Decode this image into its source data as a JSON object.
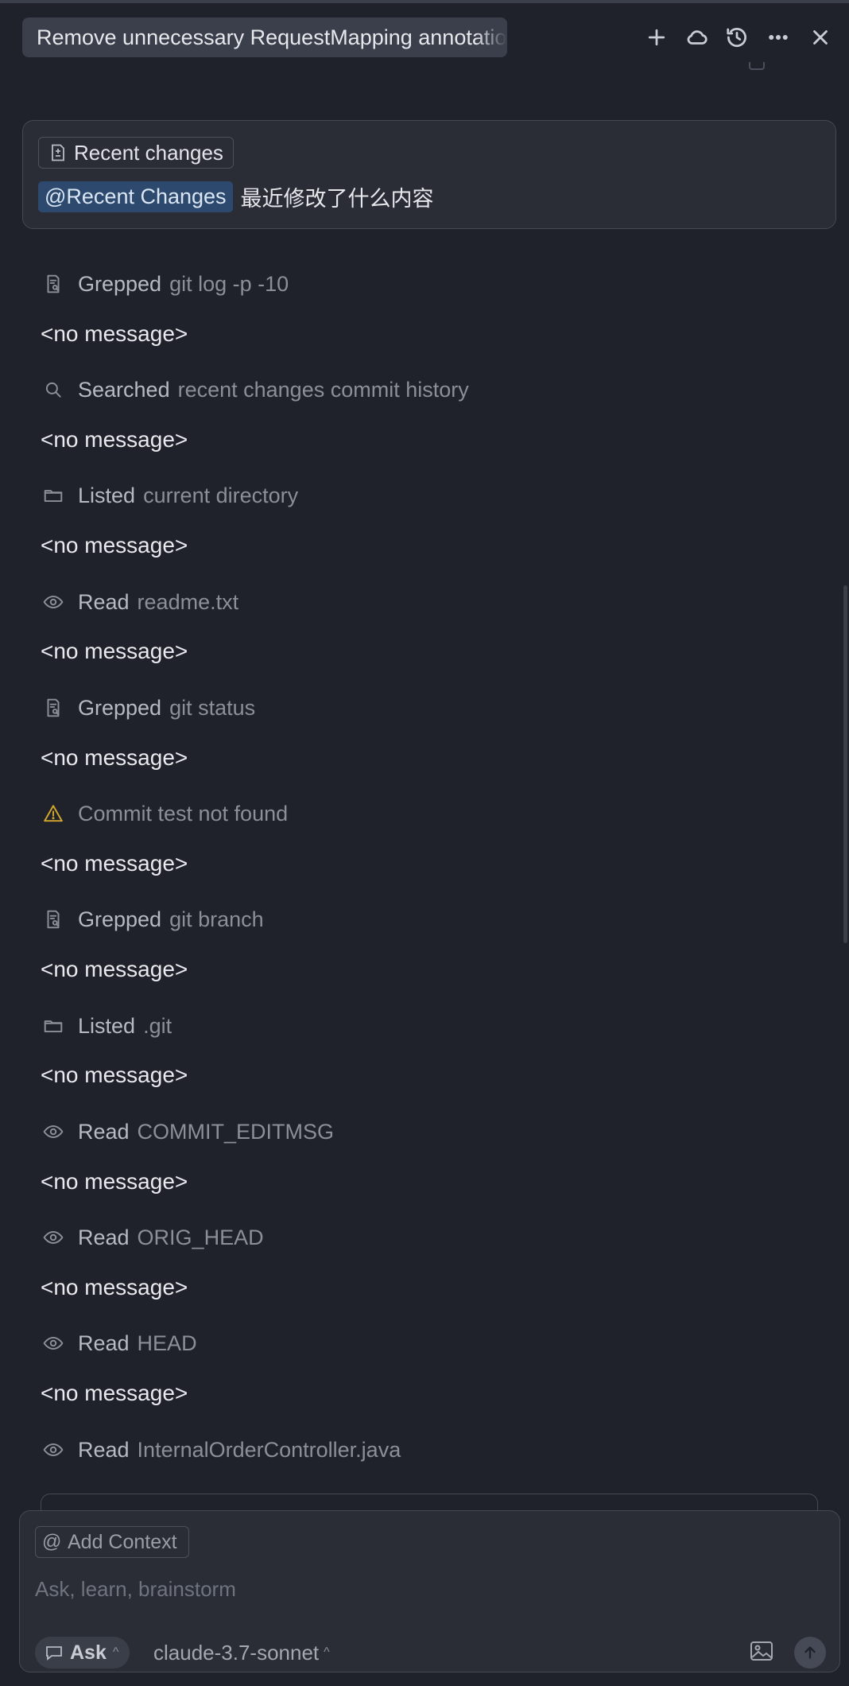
{
  "header": {
    "title": "Remove unnecessary RequestMapping annotation",
    "icons": [
      "plus-icon",
      "cloud-icon",
      "history-icon",
      "more-icon",
      "close-icon"
    ]
  },
  "user_message": {
    "chip_label": "Recent changes",
    "mention": "@Recent Changes",
    "text": "最近修改了什么内容"
  },
  "steps": [
    {
      "icon": "grep-icon",
      "verb": "Grepped",
      "target": "git log -p -10"
    },
    {
      "no_message": "<no message>"
    },
    {
      "icon": "search-icon",
      "verb": "Searched",
      "target": "recent changes commit history"
    },
    {
      "no_message": "<no message>"
    },
    {
      "icon": "folder-icon",
      "verb": "Listed",
      "target": "current directory"
    },
    {
      "no_message": "<no message>"
    },
    {
      "icon": "eye-icon",
      "verb": "Read",
      "target": "readme.txt"
    },
    {
      "no_message": "<no message>"
    },
    {
      "icon": "grep-icon",
      "verb": "Grepped",
      "target": "git status"
    },
    {
      "no_message": "<no message>"
    },
    {
      "icon": "warning-icon",
      "warning": "Commit test not found"
    },
    {
      "no_message": "<no message>"
    },
    {
      "icon": "grep-icon",
      "verb": "Grepped",
      "target": "git branch"
    },
    {
      "no_message": "<no message>"
    },
    {
      "icon": "folder-icon",
      "verb": "Listed",
      "target": ".git"
    },
    {
      "no_message": "<no message>"
    },
    {
      "icon": "eye-icon",
      "verb": "Read",
      "target": "COMMIT_EDITMSG"
    },
    {
      "no_message": "<no message>"
    },
    {
      "icon": "eye-icon",
      "verb": "Read",
      "target": "ORIG_HEAD"
    },
    {
      "no_message": "<no message>"
    },
    {
      "icon": "eye-icon",
      "verb": "Read",
      "target": "HEAD"
    },
    {
      "no_message": "<no message>"
    },
    {
      "icon": "eye-icon",
      "verb": "Read",
      "target": "InternalOrderController.java"
    }
  ],
  "composer": {
    "add_context_label": "Add Context",
    "placeholder": "Ask, learn, brainstorm",
    "mode_label": "Ask",
    "model_label": "claude-3.7-sonnet"
  },
  "colors": {
    "background": "#1f222a",
    "panel": "#2a2d36",
    "mention_bg": "#2d4a6e",
    "warning": "#d4a72c"
  }
}
